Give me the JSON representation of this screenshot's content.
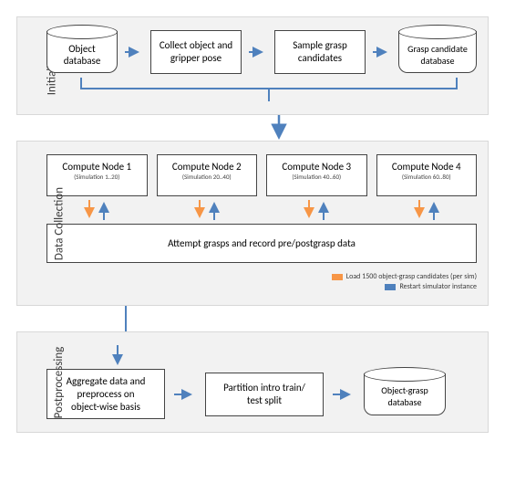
{
  "sections": {
    "initialization": {
      "label": "Initialization"
    },
    "dataCollection": {
      "label": "Data Collection"
    },
    "postprocessing": {
      "label": "Postprocessing"
    }
  },
  "initialization": {
    "objectDb": "Object\ndatabase",
    "collect": "Collect object and\ngripper pose",
    "sample": "Sample grasp\ncandidates",
    "graspDb": "Grasp candidate\ndatabase"
  },
  "dataCollection": {
    "nodes": [
      {
        "title": "Compute Node 1",
        "sub": "(Simulation 1..20)"
      },
      {
        "title": "Compute Node 2",
        "sub": "(Simulation 20..40)"
      },
      {
        "title": "Compute Node 3",
        "sub": "(Simulation 40..60)"
      },
      {
        "title": "Compute Node 4",
        "sub": "(Simulation 60..80)"
      }
    ],
    "attempt": "Attempt grasps and record pre/postgrasp data",
    "legend": {
      "orange": "Load 1500 object-grasp candidates (per sim)",
      "blue": "Restart simulator instance"
    }
  },
  "postprocessing": {
    "aggregate": "Aggregate data and\npreprocess on\nobject-wise basis",
    "partition": "Partition intro train/\ntest split",
    "objGraspDb": "Object-grasp\ndatabase"
  },
  "colors": {
    "blue": "#4f81bd",
    "orange": "#f79646"
  }
}
